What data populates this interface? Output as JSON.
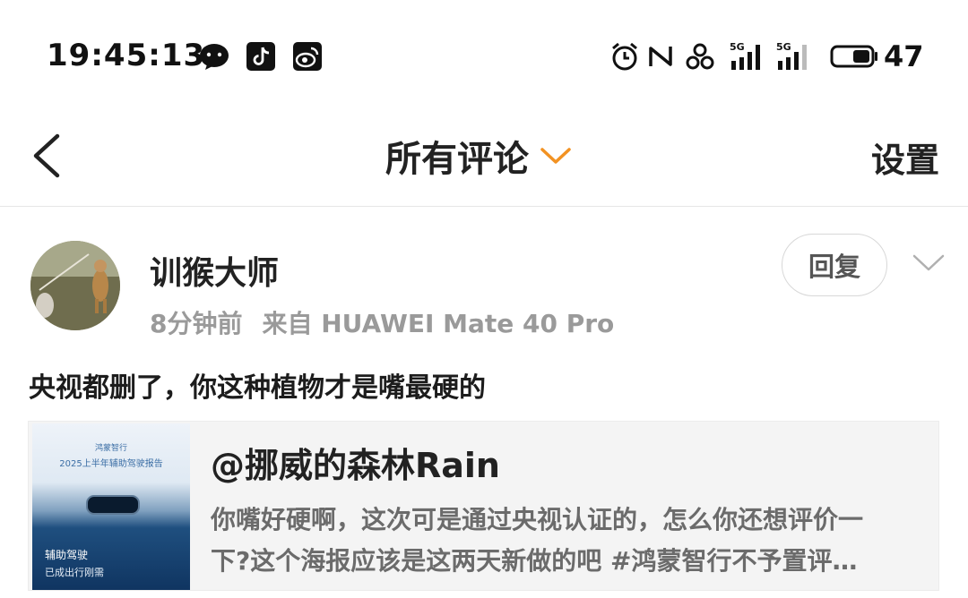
{
  "status_bar": {
    "time": "19:45:13",
    "left_icons": [
      "wechat-icon",
      "tiktok-icon",
      "weibo-icon"
    ],
    "right_icons": [
      "alarm-icon",
      "nfc-icon",
      "hotspot-icon",
      "signal-5g-icon",
      "signal-5g-icon",
      "battery-icon"
    ],
    "network_label": "5G",
    "battery": "47"
  },
  "header": {
    "back_icon": "back-chevron-icon",
    "title": "所有评论",
    "title_dropdown_icon": "chevron-down-icon",
    "settings_label": "设置",
    "accent_color": "#f29222"
  },
  "comment": {
    "avatar_icon": "user-avatar",
    "username": "训猴大师",
    "time_ago": "8分钟前",
    "source": "来自 HUAWEI Mate 40 Pro",
    "reply_label": "回复",
    "more_icon": "chevron-down-icon",
    "text": "央视都删了，你这种植物才是嘴最硬的"
  },
  "quoted_post": {
    "author": "@挪威的森林Rain",
    "text_line1": "你嘴好硬啊，这次可是通过央视认证的，怎么你还想评价一",
    "text_line2": "下?这个海报应该是这两天新做的吧 #鸿蒙智行不予置评…",
    "poster": {
      "brand": "鸿蒙智行",
      "subtitle": "2025上半年辅助驾驶报告",
      "line1": "辅助驾驶",
      "line2": "已成出行刚需"
    }
  }
}
